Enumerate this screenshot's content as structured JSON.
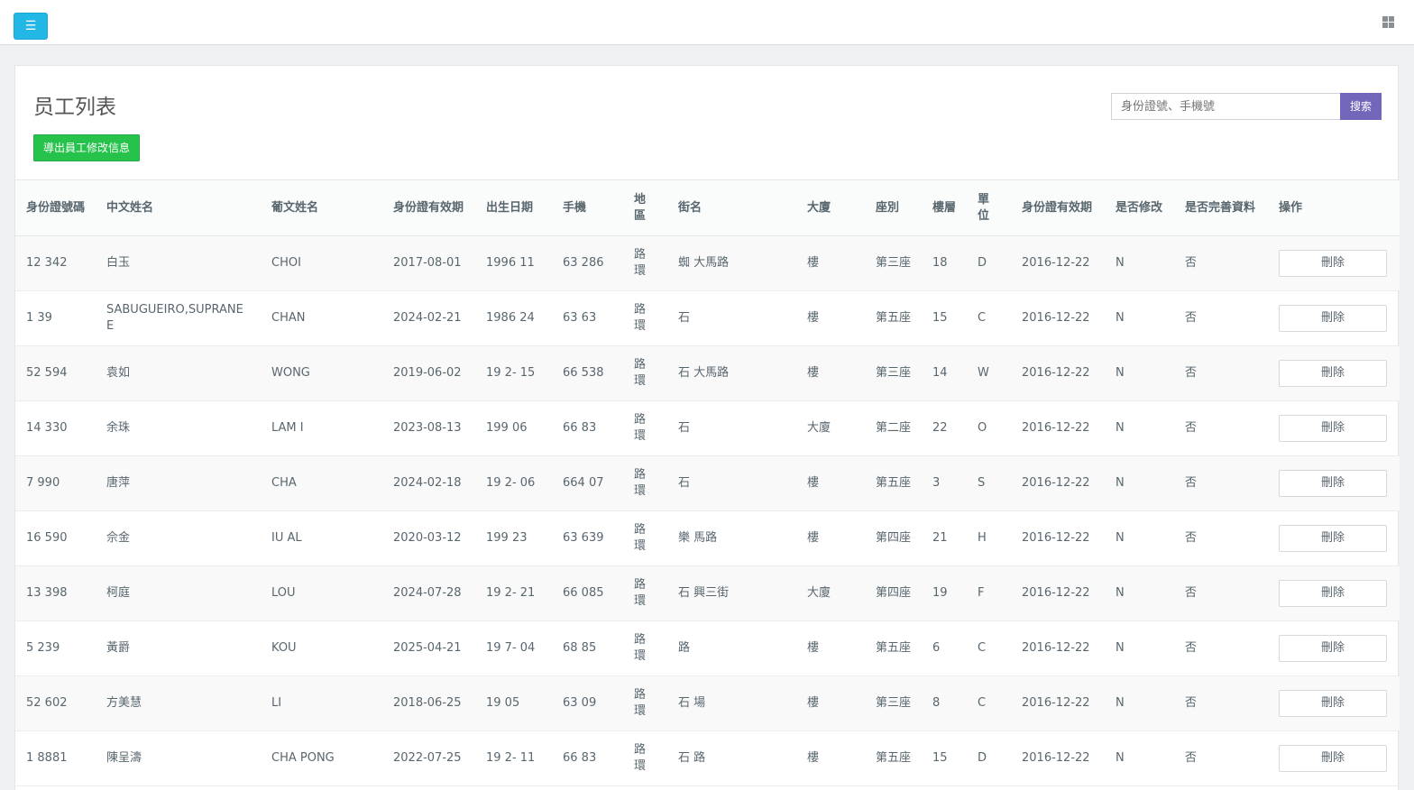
{
  "topbar": {
    "menu_icon": "hamburger-icon",
    "apps_icon": "grid-icon"
  },
  "page": {
    "title": "员工列表",
    "export_label": "導出員工修改信息",
    "search_placeholder": "身份證號、手機號",
    "search_label": "搜索"
  },
  "colors": {
    "primary": "#23b7e5",
    "success": "#27c24c",
    "search": "#7266ba"
  },
  "table": {
    "headers": [
      "身份證號碼",
      "中文姓名",
      "葡文姓名",
      "身份證有效期",
      "出生日期",
      "手機",
      "地區",
      "街名",
      "大廈",
      "座別",
      "樓層",
      "單位",
      "身份證有效期",
      "是否修改",
      "是否完善資料",
      "操作"
    ],
    "delete_label": "刪除",
    "rows": [
      {
        "id": "12 342",
        "cn": "白玉",
        "pt": "CHOI",
        "exp": "2017-08-01",
        "dob": "1996 11",
        "phone": "63 286",
        "area": "路環",
        "street": "蜘 大馬路",
        "bldg": "樓",
        "block": "第三座",
        "floor": "18",
        "unit": "D",
        "exp2": "2016-12-22",
        "mod": "N",
        "done": "否"
      },
      {
        "id": "1 39",
        "cn": "SABUGUEIRO,SUPRANEE",
        "pt": "CHAN",
        "exp": "2024-02-21",
        "dob": "1986 24",
        "phone": "63 63",
        "area": "路環",
        "street": "石",
        "bldg": "樓",
        "block": "第五座",
        "floor": "15",
        "unit": "C",
        "exp2": "2016-12-22",
        "mod": "N",
        "done": "否"
      },
      {
        "id": "52 594",
        "cn": "袁如",
        "pt": "WONG",
        "exp": "2019-06-02",
        "dob": "19 2- 15",
        "phone": "66 538",
        "area": "路環",
        "street": "石 大馬路",
        "bldg": "樓",
        "block": "第三座",
        "floor": "14",
        "unit": "W",
        "exp2": "2016-12-22",
        "mod": "N",
        "done": "否"
      },
      {
        "id": "14 330",
        "cn": "余珠",
        "pt": "LAM I",
        "exp": "2023-08-13",
        "dob": "199 06",
        "phone": "66 83",
        "area": "路環",
        "street": "石",
        "bldg": "大廈",
        "block": "第二座",
        "floor": "22",
        "unit": "O",
        "exp2": "2016-12-22",
        "mod": "N",
        "done": "否"
      },
      {
        "id": "7 990",
        "cn": "唐萍",
        "pt": "CHA",
        "exp": "2024-02-18",
        "dob": "19 2- 06",
        "phone": "664 07",
        "area": "路環",
        "street": "石",
        "bldg": "樓",
        "block": "第五座",
        "floor": "3",
        "unit": "S",
        "exp2": "2016-12-22",
        "mod": "N",
        "done": "否"
      },
      {
        "id": "16 590",
        "cn": "佘金",
        "pt": "IU AL",
        "exp": "2020-03-12",
        "dob": "199 23",
        "phone": "63 639",
        "area": "路環",
        "street": "樂 馬路",
        "bldg": "樓",
        "block": "第四座",
        "floor": "21",
        "unit": "H",
        "exp2": "2016-12-22",
        "mod": "N",
        "done": "否"
      },
      {
        "id": "13 398",
        "cn": "柯庭",
        "pt": "LOU",
        "exp": "2024-07-28",
        "dob": "19 2- 21",
        "phone": "66 085",
        "area": "路環",
        "street": "石 興三街",
        "bldg": "大廈",
        "block": "第四座",
        "floor": "19",
        "unit": "F",
        "exp2": "2016-12-22",
        "mod": "N",
        "done": "否"
      },
      {
        "id": "5 239",
        "cn": "黃爵",
        "pt": "KOU",
        "exp": "2025-04-21",
        "dob": "19 7- 04",
        "phone": "68 85",
        "area": "路環",
        "street": "路",
        "bldg": "樓",
        "block": "第五座",
        "floor": "6",
        "unit": "C",
        "exp2": "2016-12-22",
        "mod": "N",
        "done": "否"
      },
      {
        "id": "52 602",
        "cn": "方美慧",
        "pt": "LI",
        "exp": "2018-06-25",
        "dob": "19 05",
        "phone": "63 09",
        "area": "路環",
        "street": "石 場",
        "bldg": "樓",
        "block": "第三座",
        "floor": "8",
        "unit": "C",
        "exp2": "2016-12-22",
        "mod": "N",
        "done": "否"
      },
      {
        "id": "1 8881",
        "cn": "陳呈濤",
        "pt": "CHA PONG",
        "exp": "2022-07-25",
        "dob": "19 2- 11",
        "phone": "66 83",
        "area": "路環",
        "street": "石 路",
        "bldg": "樓",
        "block": "第五座",
        "floor": "15",
        "unit": "D",
        "exp2": "2016-12-22",
        "mod": "N",
        "done": "否"
      }
    ]
  }
}
